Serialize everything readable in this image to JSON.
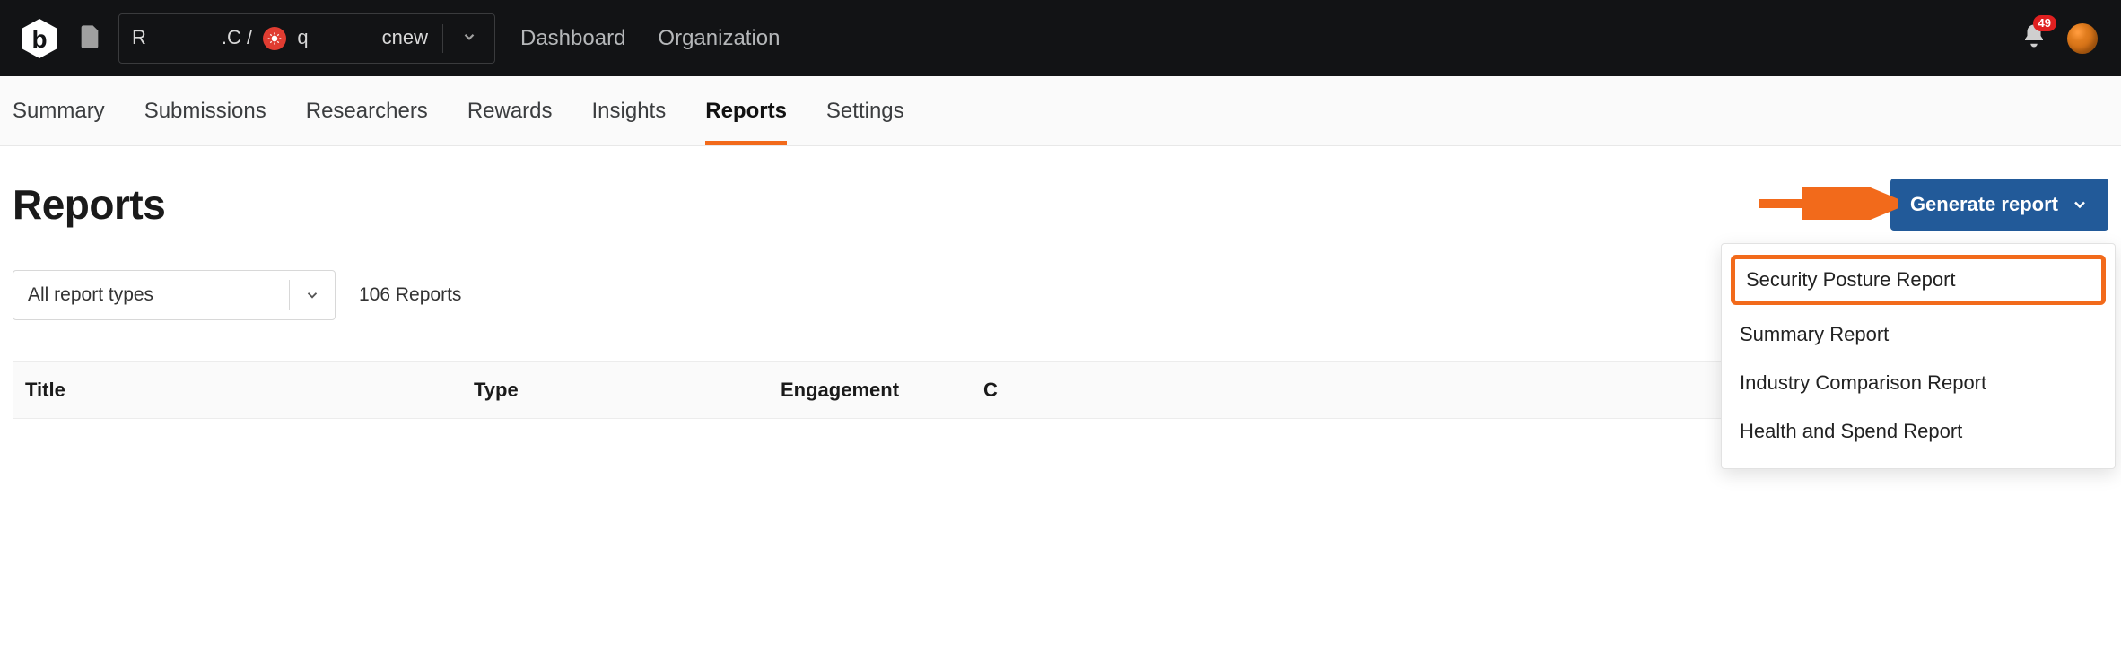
{
  "header": {
    "breadcrumb": {
      "org_prefix": "R",
      "org_suffix": ".C",
      "separator": "/",
      "proj_prefix": "q",
      "proj_suffix": "cnew"
    },
    "nav": {
      "dashboard": "Dashboard",
      "organization": "Organization"
    },
    "notification_count": "49"
  },
  "subnav": {
    "summary": "Summary",
    "submissions": "Submissions",
    "researchers": "Researchers",
    "rewards": "Rewards",
    "insights": "Insights",
    "reports": "Reports",
    "settings": "Settings"
  },
  "page": {
    "title": "Reports",
    "generate_button": "Generate report"
  },
  "dropdown": {
    "security_posture": "Security Posture Report",
    "summary_report": "Summary Report",
    "industry_comparison": "Industry Comparison Report",
    "health_spend": "Health and Spend Report"
  },
  "filters": {
    "type_select": "All report types",
    "count_text": "106 Reports"
  },
  "table": {
    "columns": {
      "title": "Title",
      "type": "Type",
      "engagement": "Engagement",
      "c": "C"
    }
  }
}
